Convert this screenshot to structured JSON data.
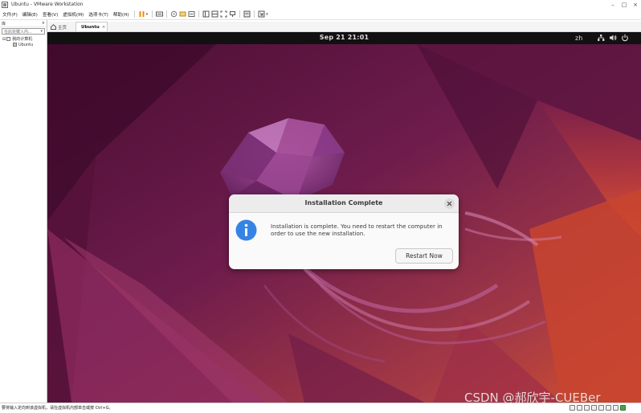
{
  "window": {
    "title": "Ubuntu - VMware Workstation",
    "minimize": "–",
    "maximize": "□",
    "close": "×"
  },
  "menu": {
    "items": [
      "文件(F)",
      "编辑(E)",
      "查看(V)",
      "虚拟机(M)",
      "选项卡(T)",
      "帮助(H)"
    ]
  },
  "library": {
    "header_label": "库",
    "header_close": "×",
    "search_placeholder": "在此处键入内...",
    "tree": [
      {
        "label": "我的计算机"
      },
      {
        "label": "Ubuntu"
      }
    ]
  },
  "tabs": {
    "home_label": "主页",
    "vm_tab_label": "Ubuntu",
    "vm_tab_close": "×"
  },
  "gnome": {
    "clock": "Sep 21  21:01",
    "language": "zh",
    "icons": [
      "network-icon",
      "volume-icon",
      "power-icon"
    ]
  },
  "dialog": {
    "title": "Installation Complete",
    "message": "Installation is complete. You need to restart the computer in order to use the new installation.",
    "button_label": "Restart Now",
    "icon": "info-icon",
    "accent": "#3584e4"
  },
  "statusbar": {
    "text": "要将输入定向到该虚拟机，请在虚拟机内部单击或按 Ctrl+G。"
  },
  "watermark": "CSDN @郝欣宇-CUEBer",
  "colors": {
    "wallpaper_dark": "#2c001e",
    "wallpaper_purple": "#77216f",
    "wallpaper_orange": "#e95420"
  }
}
